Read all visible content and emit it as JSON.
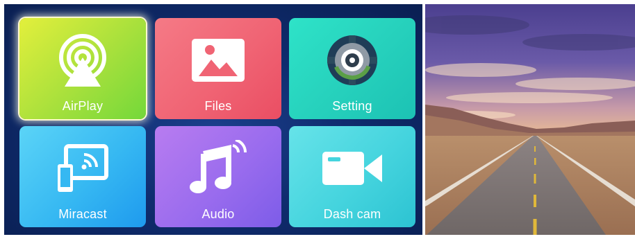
{
  "tiles": {
    "airplay": {
      "label": "AirPlay",
      "icon": "airplay-icon",
      "selected": true
    },
    "files": {
      "label": "Files",
      "icon": "image-icon"
    },
    "setting": {
      "label": "Setting",
      "icon": "gear-icon"
    },
    "miracast": {
      "label": "Miracast",
      "icon": "screen-cast-icon"
    },
    "audio": {
      "label": "Audio",
      "icon": "music-note-icon"
    },
    "dashcam": {
      "label": "Dash cam",
      "icon": "video-camera-icon"
    }
  },
  "colors": {
    "background": "#0f2c6e",
    "airplay": "#a7e03c",
    "files": "#f06474",
    "setting": "#27d2bd",
    "miracast": "#36b8f2",
    "audio": "#9a6cee",
    "dashcam": "#45d4de"
  }
}
